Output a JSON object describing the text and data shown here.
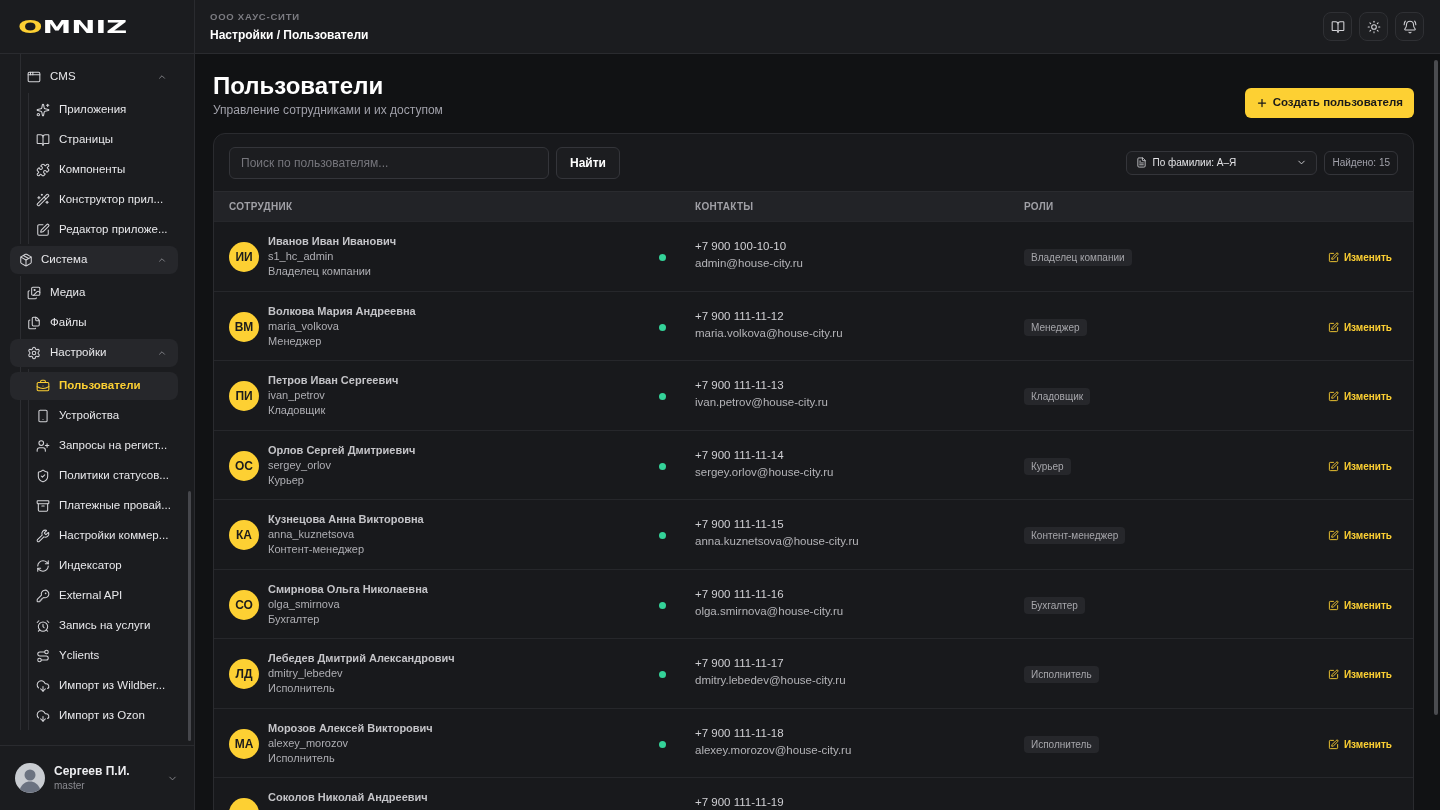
{
  "sidebar": {
    "logo": "OMNIZ",
    "nav": [
      {
        "kind": "continuation",
        "children": [
          {
            "kind": "group",
            "label": "CMS",
            "expanded": true,
            "active": false,
            "children": [
              {
                "kind": "link",
                "label": "Приложения",
                "selected": false
              },
              {
                "kind": "link",
                "label": "Страницы",
                "selected": false
              },
              {
                "kind": "link",
                "label": "Компоненты",
                "selected": false
              },
              {
                "kind": "link",
                "label": "Конструктор прил...",
                "selected": false
              },
              {
                "kind": "link",
                "label": "Редактор приложе...",
                "selected": false
              }
            ]
          }
        ]
      },
      {
        "kind": "group",
        "label": "Система",
        "expanded": true,
        "active": true,
        "children": [
          {
            "kind": "link",
            "label": "Медиа",
            "selected": false
          },
          {
            "kind": "link",
            "label": "Файлы",
            "selected": false
          },
          {
            "kind": "group",
            "label": "Настройки",
            "expanded": true,
            "active": true,
            "children": [
              {
                "kind": "link",
                "label": "Пользователи",
                "selected": true
              },
              {
                "kind": "link",
                "label": "Устройства",
                "selected": false
              },
              {
                "kind": "link",
                "label": "Запросы на регист...",
                "selected": false
              },
              {
                "kind": "link",
                "label": "Политики статусов...",
                "selected": false
              },
              {
                "kind": "link",
                "label": "Платежные провай...",
                "selected": false
              },
              {
                "kind": "link",
                "label": "Настройки коммер...",
                "selected": false
              },
              {
                "kind": "link",
                "label": "Индексатор",
                "selected": false
              },
              {
                "kind": "link",
                "label": "External API",
                "selected": false
              },
              {
                "kind": "link",
                "label": "Запись на услуги",
                "selected": false
              },
              {
                "kind": "link",
                "label": "Yclients",
                "selected": false
              },
              {
                "kind": "link",
                "label": "Импорт из Wildber...",
                "selected": false
              },
              {
                "kind": "link",
                "label": "Импорт из Ozon",
                "selected": false
              }
            ]
          }
        ]
      }
    ],
    "user": {
      "name": "Сергеев П.И.",
      "role": "master"
    }
  },
  "header": {
    "organization": "ООО ХАУС-СИТИ",
    "breadcrumb": "Настройки / Пользователи"
  },
  "page": {
    "title": "Пользователи",
    "subtitle": "Управление сотрудниками и их доступом",
    "create_button": "Создать пользователя"
  },
  "toolbar": {
    "search": {
      "placeholder": "Поиск по пользователям..."
    },
    "search_button": "Найти",
    "sort": {
      "value": "По фамилии: А–Я"
    },
    "found": "Найдено: 15"
  },
  "table": {
    "columns": [
      "СОТРУДНИК",
      "КОНТАКТЫ",
      "РОЛИ"
    ],
    "rows": [
      {
        "initials": "ИИ",
        "name": "Иванов Иван Иванович",
        "login": "s1_hc_admin",
        "position": "Владелец компании",
        "online": true,
        "phone": "+7 900 100-10-10",
        "email": "admin@house-city.ru",
        "role": "Владелец компании",
        "action": "Изменить"
      },
      {
        "initials": "ВМ",
        "name": "Волкова Мария Андреевна",
        "login": "maria_volkova",
        "position": "Менеджер",
        "online": true,
        "phone": "+7 900 111-11-12",
        "email": "maria.volkova@house-city.ru",
        "role": "Менеджер",
        "action": "Изменить"
      },
      {
        "initials": "ПИ",
        "name": "Петров Иван Сергеевич",
        "login": "ivan_petrov",
        "position": "Кладовщик",
        "online": true,
        "phone": "+7 900 111-11-13",
        "email": "ivan.petrov@house-city.ru",
        "role": "Кладовщик",
        "action": "Изменить"
      },
      {
        "initials": "ОС",
        "name": "Орлов Сергей Дмитриевич",
        "login": "sergey_orlov",
        "position": "Курьер",
        "online": true,
        "phone": "+7 900 111-11-14",
        "email": "sergey.orlov@house-city.ru",
        "role": "Курьер",
        "action": "Изменить"
      },
      {
        "initials": "КА",
        "name": "Кузнецова Анна Викторовна",
        "login": "anna_kuznetsova",
        "position": "Контент-менеджер",
        "online": true,
        "phone": "+7 900 111-11-15",
        "email": "anna.kuznetsova@house-city.ru",
        "role": "Контент-менеджер",
        "action": "Изменить"
      },
      {
        "initials": "СО",
        "name": "Смирнова Ольга Николаевна",
        "login": "olga_smirnova",
        "position": "Бухгалтер",
        "online": true,
        "phone": "+7 900 111-11-16",
        "email": "olga.smirnova@house-city.ru",
        "role": "Бухгалтер",
        "action": "Изменить"
      },
      {
        "initials": "ЛД",
        "name": "Лебедев Дмитрий Александрович",
        "login": "dmitry_lebedev",
        "position": "Исполнитель",
        "online": true,
        "phone": "+7 900 111-11-17",
        "email": "dmitry.lebedev@house-city.ru",
        "role": "Исполнитель",
        "action": "Изменить"
      },
      {
        "initials": "МА",
        "name": "Морозов Алексей Викторович",
        "login": "alexey_morozov",
        "position": "Исполнитель",
        "online": true,
        "phone": "+7 900 111-11-18",
        "email": "alexey.morozov@house-city.ru",
        "role": "Исполнитель",
        "action": "Изменить"
      },
      {
        "name": "Соколов Николай Андреевич",
        "phone": "+7 900 111-11-19"
      }
    ]
  }
}
